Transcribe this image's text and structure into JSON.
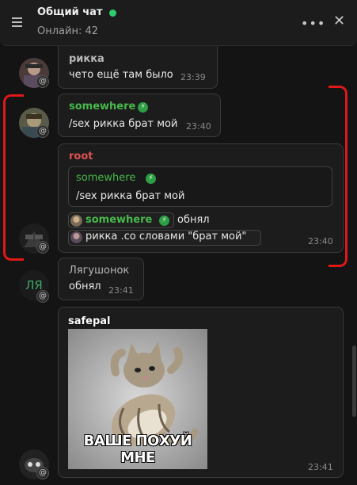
{
  "header": {
    "title": "Общий чат",
    "online": "Онлайн: 42",
    "more_label": "•••",
    "close_label": "✕"
  },
  "messages": [
    {
      "sender": "рикка",
      "text": "чето ещё там было",
      "time": "23:39"
    },
    {
      "sender": "somewhere",
      "text": "/sex рикка брат мой",
      "time": "23:40"
    },
    {
      "sender": "root",
      "quote_sender": "somewhere",
      "quote_text": "/sex рикка брат мой",
      "action1_user": "somewhere",
      "action1_text": "обнял",
      "action2_text": "рикка .co словами \"брат мой\"",
      "time": "23:40"
    },
    {
      "sender": "Лягушонок",
      "text": "обнял",
      "time": "23:41",
      "avatar_letters": "ЛЯ"
    },
    {
      "sender": "safepal",
      "caption": "ВАШЕ ПОХУЙ МНЕ",
      "time": "23:41"
    }
  ],
  "badge_symbol": "@",
  "bolt_symbol": "⚡",
  "colors": {
    "online": "#2ecc71",
    "verified": "#47b84a",
    "root": "#e05050",
    "annotation": "#e01818"
  }
}
